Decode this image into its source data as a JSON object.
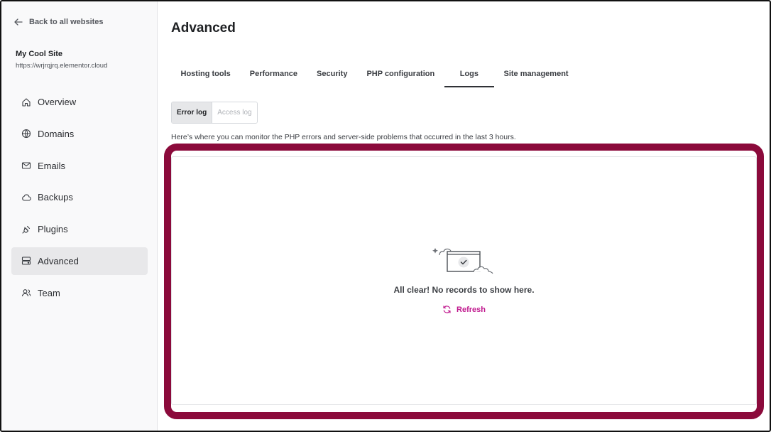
{
  "sidebar": {
    "back_label": "Back to all websites",
    "site_name": "My Cool Site",
    "site_url": "https://wrjrqjrq.elementor.cloud",
    "items": [
      {
        "label": "Overview",
        "icon": "home-icon",
        "active": false
      },
      {
        "label": "Domains",
        "icon": "globe-icon",
        "active": false
      },
      {
        "label": "Emails",
        "icon": "envelope-icon",
        "active": false
      },
      {
        "label": "Backups",
        "icon": "cloud-icon",
        "active": false
      },
      {
        "label": "Plugins",
        "icon": "plug-icon",
        "active": false
      },
      {
        "label": "Advanced",
        "icon": "server-icon",
        "active": true
      },
      {
        "label": "Team",
        "icon": "users-icon",
        "active": false
      }
    ]
  },
  "main": {
    "title": "Advanced",
    "tabs": [
      {
        "label": "Hosting tools",
        "active": false
      },
      {
        "label": "Performance",
        "active": false
      },
      {
        "label": "Security",
        "active": false
      },
      {
        "label": "PHP configuration",
        "active": false
      },
      {
        "label": "Logs",
        "active": true
      },
      {
        "label": "Site management",
        "active": false
      }
    ],
    "log_switch": {
      "error_log": "Error log",
      "access_log": "Access log",
      "selected": "Error log"
    },
    "description": "Here’s where you can monitor the PHP errors and server-side problems that occurred in the last 3 hours.",
    "empty_state": {
      "message": "All clear! No records to show here.",
      "refresh_label": "Refresh",
      "illustration_icon": "monitor-checkmark-icon"
    }
  },
  "colors": {
    "accent": "#c0198e",
    "highlight_border": "#8b0a3b",
    "sidebar_bg": "#f9f9fa",
    "active_nav_bg": "#e8e8ea"
  }
}
